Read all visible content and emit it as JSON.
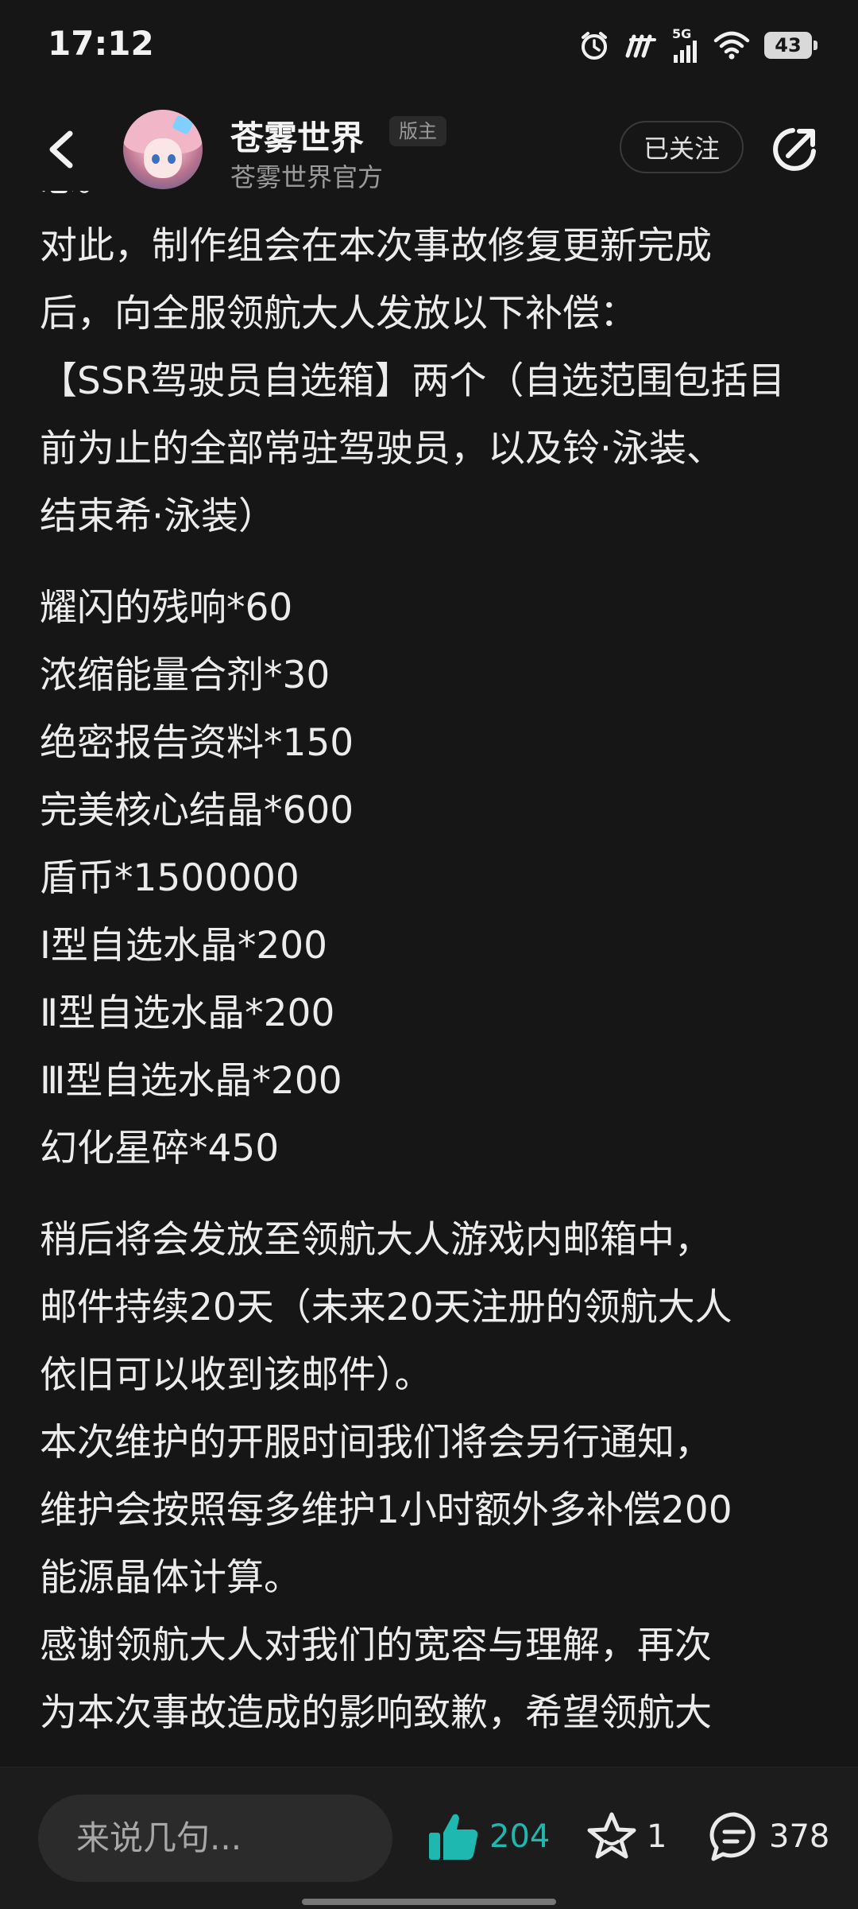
{
  "status": {
    "time": "17:12",
    "network": "5G",
    "battery": "43"
  },
  "header": {
    "author": "苍雾世界",
    "badge": "版主",
    "subtitle": "苍雾世界官方",
    "follow_label": "已关注"
  },
  "content": {
    "partial_top": "恩。",
    "lines": [
      "对此，制作组会在本次事故修复更新完成",
      "后，向全服领航大人发放以下补偿：",
      "【SSR驾驶员自选箱】两个（自选范围包括目",
      "前为止的全部常驻驾驶员，以及铃·泳装、",
      "结束希·泳装）"
    ],
    "rewards": [
      "耀闪的残响*60",
      "浓缩能量合剂*30",
      "绝密报告资料*150",
      "完美核心结晶*600",
      "盾币*1500000",
      "Ⅰ型自选水晶*200",
      "Ⅱ型自选水晶*200",
      "Ⅲ型自选水晶*200",
      "幻化星碎*450"
    ],
    "closing": [
      "稍后将会发放至领航大人游戏内邮箱中，",
      "邮件持续20天（未来20天注册的领航大人",
      "依旧可以收到该邮件）。",
      "本次维护的开服时间我们将会另行通知，",
      "维护会按照每多维护1小时额外多补偿200",
      "能源晶体计算。",
      "感谢领航大人对我们的宽容与理解，再次",
      "为本次事故造成的影响致歉，希望领航大"
    ]
  },
  "bottom": {
    "comment_placeholder": "来说几句...",
    "likes": "204",
    "favorites": "1",
    "comments": "378"
  },
  "colors": {
    "background": "#161616",
    "accent_like": "#1fb8b0",
    "text": "#ececec",
    "muted": "#9a9a9a"
  }
}
